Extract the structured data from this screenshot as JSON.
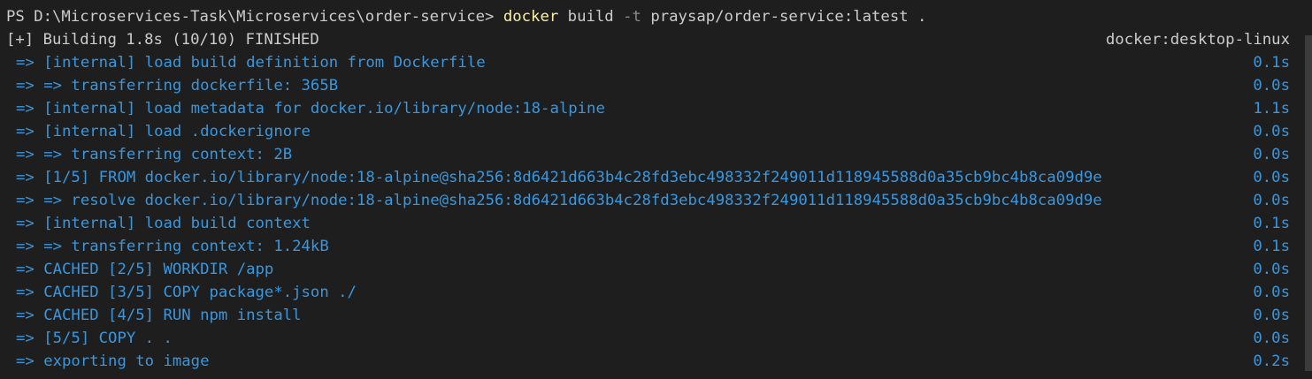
{
  "prompt": {
    "path": "PS D:\\Microservices-Task\\Microservices\\order-service> ",
    "command": "docker",
    "arg1": " build ",
    "flag": "-t",
    "arg2": " praysap/order-service:latest ."
  },
  "status": {
    "text": "[+] Building 1.8s (10/10) FINISHED",
    "context": "docker:desktop-linux"
  },
  "steps": [
    {
      "text": "=> [internal] load build definition from Dockerfile",
      "time": "0.1s"
    },
    {
      "text": "=> => transferring dockerfile: 365B",
      "time": "0.0s"
    },
    {
      "text": "=> [internal] load metadata for docker.io/library/node:18-alpine",
      "time": "1.1s"
    },
    {
      "text": "=> [internal] load .dockerignore",
      "time": "0.0s"
    },
    {
      "text": "=> => transferring context: 2B",
      "time": "0.0s"
    },
    {
      "text": "=> [1/5] FROM docker.io/library/node:18-alpine@sha256:8d6421d663b4c28fd3ebc498332f249011d118945588d0a35cb9bc4b8ca09d9e",
      "time": "0.0s"
    },
    {
      "text": "=> => resolve docker.io/library/node:18-alpine@sha256:8d6421d663b4c28fd3ebc498332f249011d118945588d0a35cb9bc4b8ca09d9e",
      "time": "0.0s"
    },
    {
      "text": "=> [internal] load build context",
      "time": "0.1s"
    },
    {
      "text": "=> => transferring context: 1.24kB",
      "time": "0.1s"
    },
    {
      "text": "=> CACHED [2/5] WORKDIR /app",
      "time": "0.0s"
    },
    {
      "text": "=> CACHED [3/5] COPY package*.json ./",
      "time": "0.0s"
    },
    {
      "text": "=> CACHED [4/5] RUN npm install",
      "time": "0.0s"
    },
    {
      "text": "=> [5/5] COPY . .",
      "time": "0.0s"
    },
    {
      "text": "=> exporting to image",
      "time": "0.2s"
    }
  ],
  "colors": {
    "background": "#1e1e1e",
    "text": "#cccccc",
    "step": "#3a96dd",
    "command": "#f9f1a5",
    "flag": "#8a8a8a"
  }
}
